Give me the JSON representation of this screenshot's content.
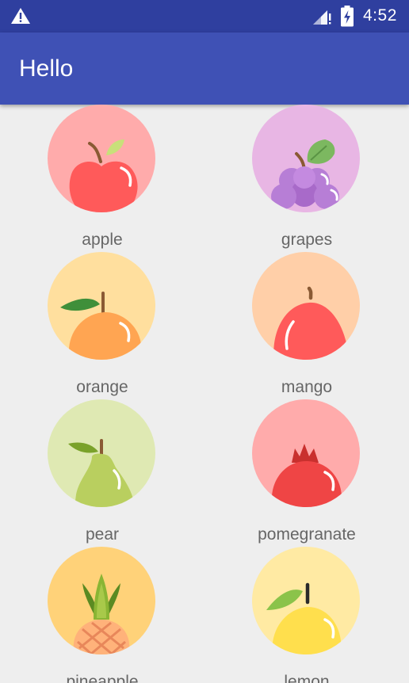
{
  "status_bar": {
    "time": "4:52"
  },
  "app_bar": {
    "title": "Hello"
  },
  "fruits": [
    {
      "label": "apple"
    },
    {
      "label": "grapes"
    },
    {
      "label": "orange"
    },
    {
      "label": "mango"
    },
    {
      "label": "pear"
    },
    {
      "label": "pomegranate"
    },
    {
      "label": "pineapple"
    },
    {
      "label": "lemon"
    }
  ],
  "colors": {
    "status_bar": "#2f3f9f",
    "app_bar": "#3f51b5",
    "background": "#eeeeee",
    "label_text": "#666666",
    "apple_bg": "#ffabab",
    "grapes_bg": "#e8b6e4",
    "orange_bg": "#ffdf9e",
    "mango_bg": "#ffcfa8",
    "pear_bg": "#dfe9b3",
    "pomegranate_bg": "#ffabab",
    "pineapple_bg": "#ffd279",
    "lemon_bg": "#ffeaa3"
  }
}
